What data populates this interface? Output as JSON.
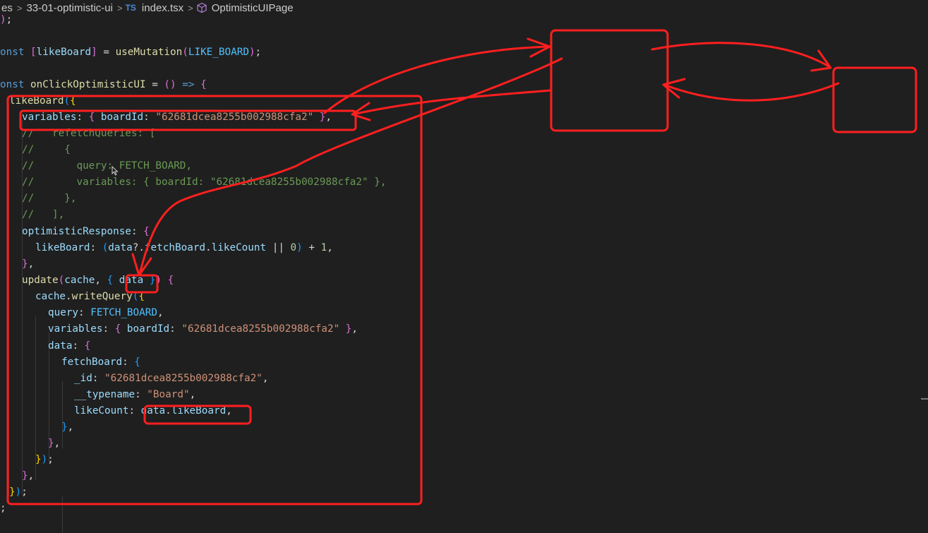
{
  "breadcrumb": {
    "items": [
      "es",
      "33-01-optimistic-ui",
      "index.tsx",
      "OptimisticUIPage"
    ],
    "separator": ">",
    "file_type_badge": "TS",
    "symbol_icon": "cube-icon"
  },
  "code": {
    "lines": [
      ");",
      "",
      "onst [likeBoard] = useMutation(LIKE_BOARD);",
      "",
      "onst onClickOptimisticUI = () => {",
      "  likeBoard({",
      "    variables: { boardId: \"62681dcea8255b002988cfa2\" },",
      "    //   refetchQueries: [",
      "    //     {",
      "    //       query: FETCH_BOARD,",
      "    //       variables: { boardId: \"62681dcea8255b002988cfa2\" },",
      "    //     },",
      "    //   ],",
      "    optimisticResponse: {",
      "      likeBoard: (data?.fetchBoard.likeCount || 0) + 1,",
      "    },",
      "    update(cache, { data }) {",
      "      cache.writeQuery({",
      "        query: FETCH_BOARD,",
      "        variables: { boardId: \"62681dcea8255b002988cfa2\" },",
      "        data: {",
      "          fetchBoard: {",
      "            _id: \"62681dcea8255b002988cfa2\",",
      "            __typename: \"Board\",",
      "            likeCount: data.likeBoard,",
      "          },",
      "        },",
      "      });",
      "    },",
      "  });",
      ";"
    ]
  },
  "colors": {
    "background": "#1f1f1f",
    "annotation_red": "#ff1f1f",
    "keyword": "#569cd6",
    "variable": "#9cdcfe",
    "function": "#dcdcaa",
    "string": "#ce9178",
    "comment": "#6a9955",
    "constant": "#4fc1ff"
  }
}
